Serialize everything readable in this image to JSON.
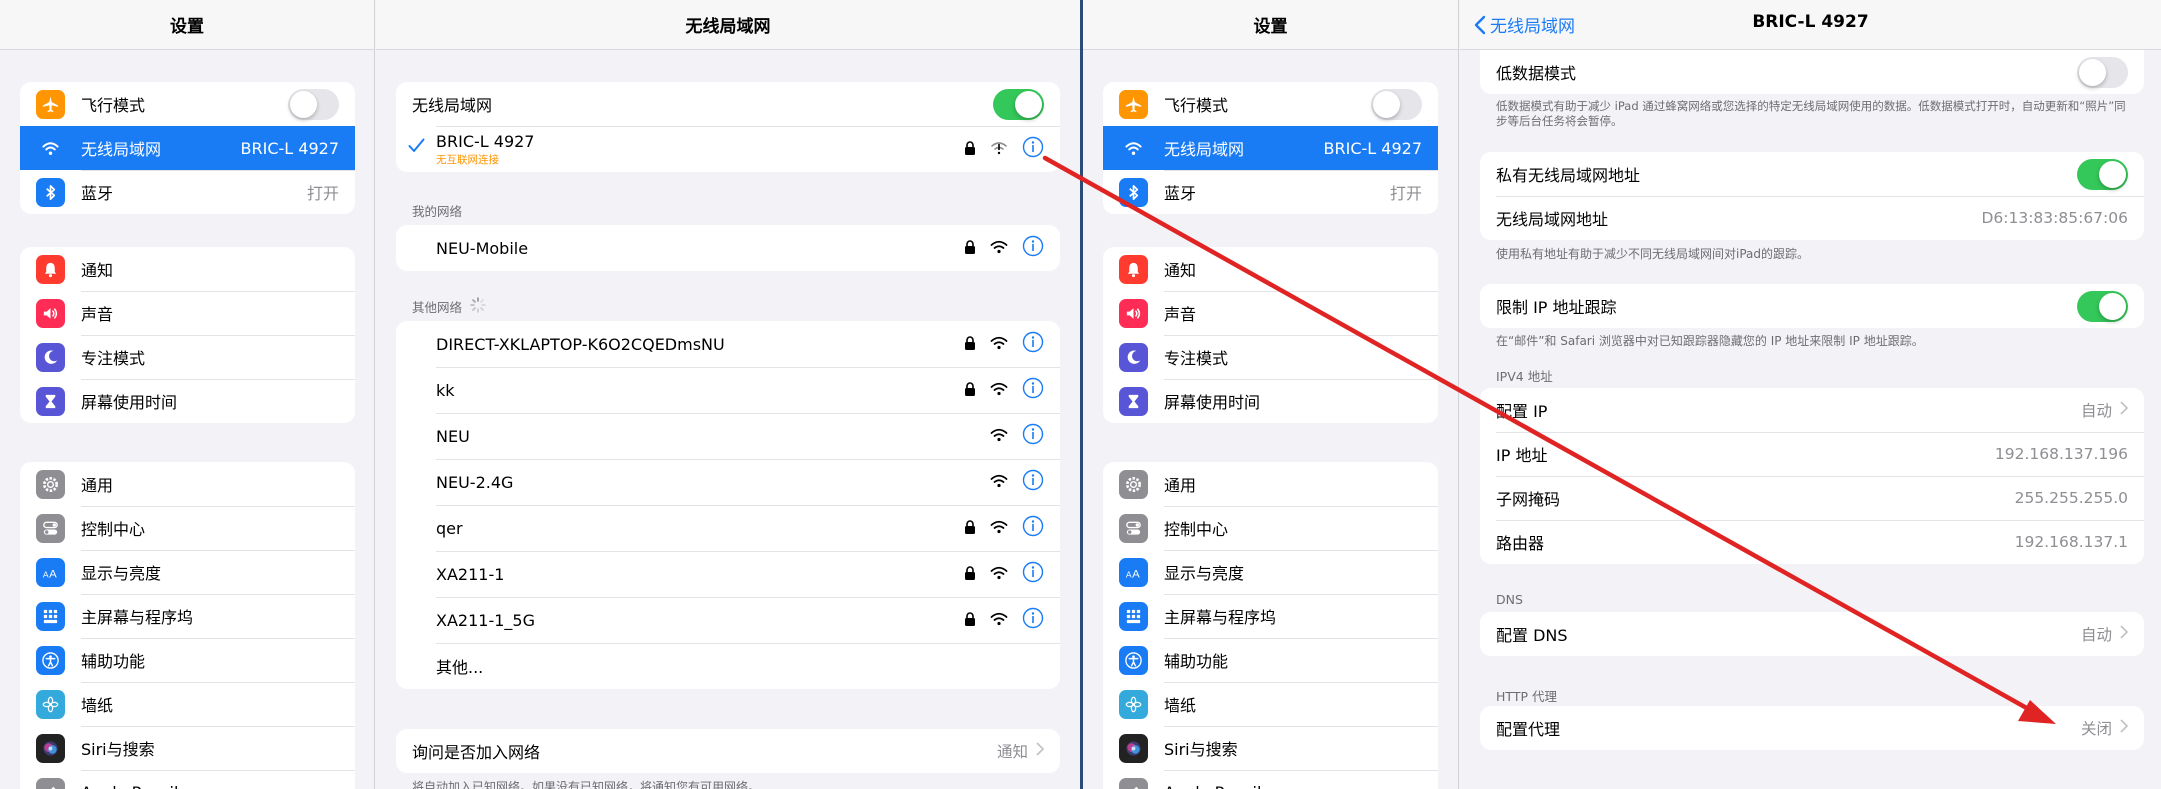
{
  "left_screen": {
    "sidebar": {
      "title": "设置",
      "groups": [
        [
          {
            "label": "飞行模式",
            "icon": "airplane-icon",
            "color": "#ff9500",
            "type": "toggle_off"
          },
          {
            "label": "无线局域网",
            "icon": "wifi-icon",
            "color": "#1a7cf5",
            "value": "BRIC-L 4927",
            "active": true
          },
          {
            "label": "蓝牙",
            "icon": "bluetooth-icon",
            "color": "#1a7cf5",
            "value": "打开"
          }
        ],
        [
          {
            "label": "通知",
            "icon": "bell-icon",
            "color": "#ff3b30"
          },
          {
            "label": "声音",
            "icon": "speaker-icon",
            "color": "#ff2d55"
          },
          {
            "label": "专注模式",
            "icon": "moon-icon",
            "color": "#5856d6"
          },
          {
            "label": "屏幕使用时间",
            "icon": "hourglass-icon",
            "color": "#5856d6"
          }
        ],
        [
          {
            "label": "通用",
            "icon": "gear-icon",
            "color": "#8e8e93"
          },
          {
            "label": "控制中心",
            "icon": "switches-icon",
            "color": "#8e8e93"
          },
          {
            "label": "显示与亮度",
            "icon": "text-size-icon",
            "color": "#1a7cf5"
          },
          {
            "label": "主屏幕与程序坞",
            "icon": "grid-icon",
            "color": "#1a7cf5"
          },
          {
            "label": "辅助功能",
            "icon": "accessibility-icon",
            "color": "#1a7cf5"
          },
          {
            "label": "墙纸",
            "icon": "flower-icon",
            "color": "#34aadc"
          },
          {
            "label": "Siri与搜索",
            "icon": "siri-icon",
            "color": "#222222"
          },
          {
            "label": "Apple Pencil",
            "icon": "pencil-icon",
            "color": "#8e8e93"
          }
        ]
      ]
    },
    "detail": {
      "title": "无线局域网",
      "wifi_toggle_label": "无线局域网",
      "connected": {
        "name": "BRIC-L 4927",
        "status": "无互联网连接"
      },
      "my_networks_label": "我的网络",
      "my_networks": [
        {
          "name": "NEU-Mobile",
          "lock": true
        }
      ],
      "other_networks_label": "其他网络",
      "other_networks": [
        {
          "name": "DIRECT-XKLAPTOP-K6O2CQEDmsNU",
          "lock": true
        },
        {
          "name": "kk",
          "lock": true
        },
        {
          "name": "NEU",
          "lock": false
        },
        {
          "name": "NEU-2.4G",
          "lock": false
        },
        {
          "name": "qer",
          "lock": true
        },
        {
          "name": "XA211-1",
          "lock": true
        },
        {
          "name": "XA211-1_5G",
          "lock": true
        }
      ],
      "other_label": "其他...",
      "ask_join_label": "询问是否加入网络",
      "ask_join_value": "通知",
      "ask_join_footnote": "将自动加入已知网络。如果没有已知网络，将通知您有可用网络。"
    }
  },
  "right_screen": {
    "detail": {
      "back_label": "无线局域网",
      "title": "BRIC-L 4927",
      "low_data_label": "低数据模式",
      "low_data_footnote": "低数据模式有助于减少 iPad 通过蜂窝网络或您选择的特定无线局域网使用的数据。低数据模式打开时，自动更新和“照片”同步等后台任务将会暂停。",
      "private_addr_label": "私有无线局域网地址",
      "wifi_addr_label": "无线局域网地址",
      "wifi_addr_value": "D6:13:83:85:67:06",
      "private_footnote": "使用私有地址有助于减少不同无线局域网间对iPad的跟踪。",
      "limit_ip_label": "限制 IP 地址跟踪",
      "limit_ip_footnote": "在“邮件”和 Safari 浏览器中对已知跟踪器隐藏您的 IP 地址来限制 IP 地址跟踪。",
      "ipv4_label": "IPV4 地址",
      "ipv4_rows": [
        {
          "k": "配置 IP",
          "v": "自动",
          "chevron": true
        },
        {
          "k": "IP 地址",
          "v": "192.168.137.196"
        },
        {
          "k": "子网掩码",
          "v": "255.255.255.0"
        },
        {
          "k": "路由器",
          "v": "192.168.137.1"
        }
      ],
      "dns_label": "DNS",
      "dns_row": {
        "k": "配置 DNS",
        "v": "自动"
      },
      "http_label": "HTTP 代理",
      "proxy_row": {
        "k": "配置代理",
        "v": "关闭"
      }
    }
  },
  "colors": {
    "accent": "#1a7cf5",
    "toggle_on": "#34c759",
    "warning": "#ff9500",
    "annotation_arrow": "#e02424"
  }
}
